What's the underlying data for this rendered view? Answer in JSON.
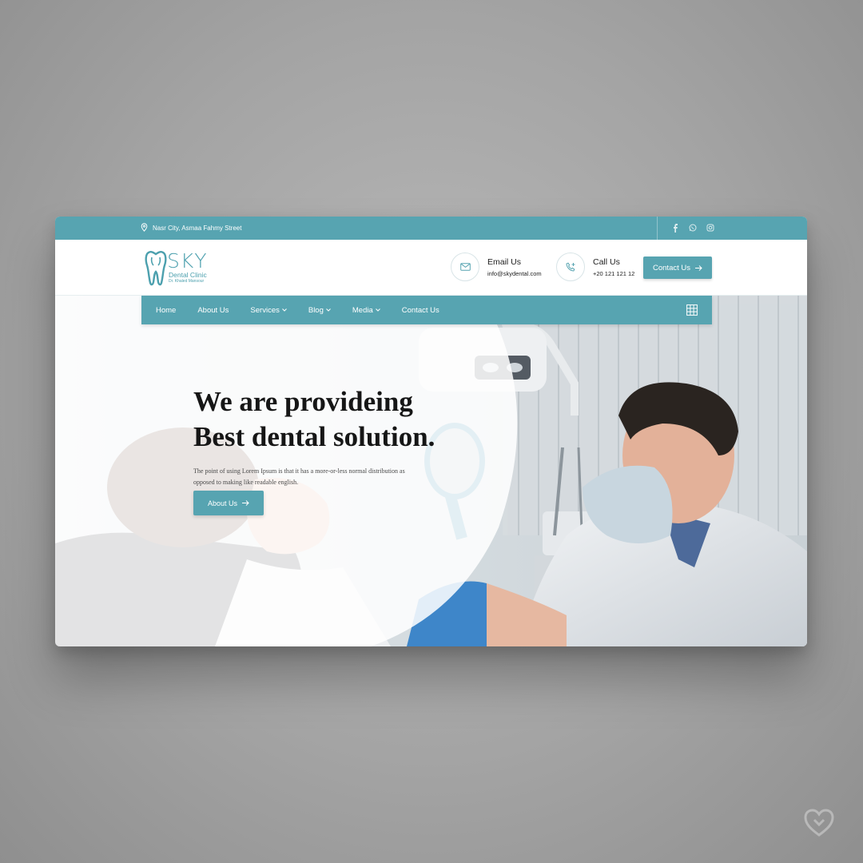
{
  "topbar": {
    "address": "Nasr City, Asmaa Fahmy Street",
    "social_icons": [
      "facebook-icon",
      "whatsapp-icon",
      "instagram-icon"
    ]
  },
  "logo": {
    "brand": "SKY",
    "subtitle": "Dental Clinic",
    "doctor": "Dr. Khaled Mansour"
  },
  "header": {
    "email": {
      "title": "Email Us",
      "value": "info@skydental.com"
    },
    "call": {
      "title": "Call Us",
      "value": "+20 121 121 12"
    },
    "contact_button": "Contact Us"
  },
  "nav": {
    "items": [
      {
        "label": "Home",
        "dropdown": false
      },
      {
        "label": "About Us",
        "dropdown": false
      },
      {
        "label": "Services",
        "dropdown": true
      },
      {
        "label": "Blog",
        "dropdown": true
      },
      {
        "label": "Media",
        "dropdown": true
      },
      {
        "label": "Contact Us",
        "dropdown": false
      }
    ]
  },
  "hero": {
    "title_line1": "We are provideing",
    "title_line2": "Best dental solution.",
    "description": "The point of using Lorem Ipsum is that it has a more-or-less normal distribution as opposed to making like readable english.",
    "button": "About Us"
  },
  "colors": {
    "accent": "#57a4b1",
    "heading": "#161616",
    "background": "#a4a4a4"
  }
}
